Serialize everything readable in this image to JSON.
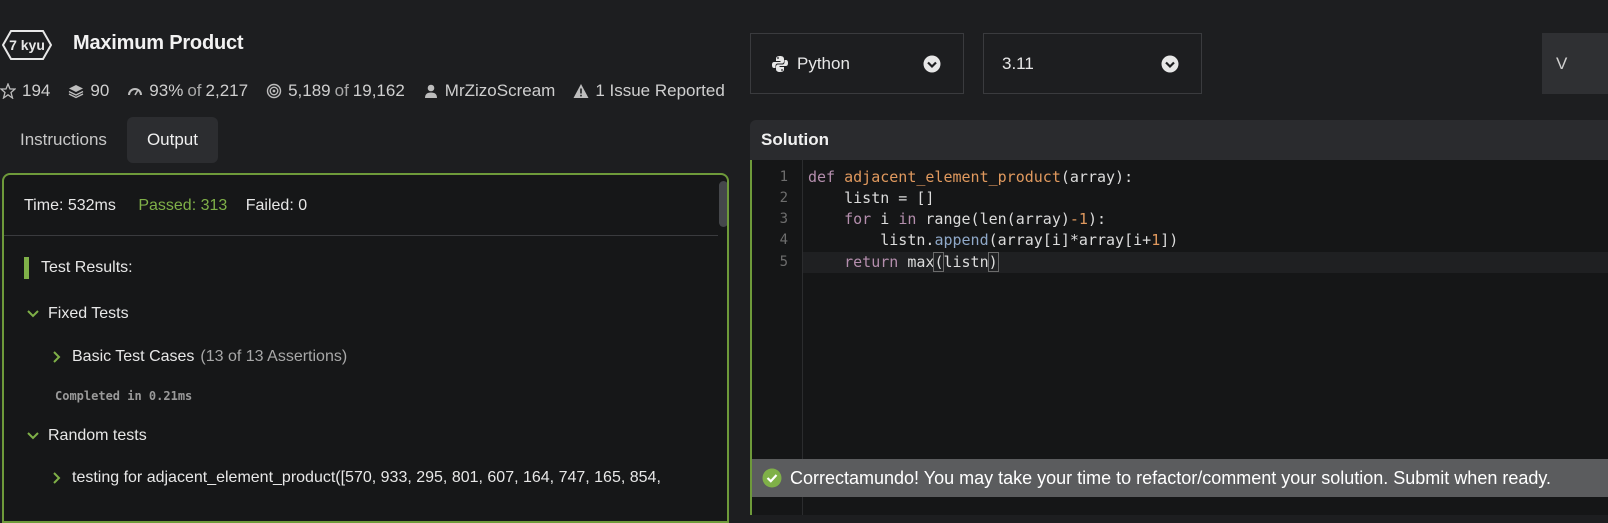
{
  "kata": {
    "rank": "7 kyu",
    "title": "Maximum Product",
    "stats": {
      "stars": "194",
      "collections": "90",
      "satisfaction_pct": "93%",
      "satisfaction_of": "of",
      "satisfaction_votes": "2,217",
      "completed": "5,189",
      "completed_of": "of",
      "completed_total": "19,162",
      "author": "MrZizoScream",
      "issues": "1 Issue Reported"
    }
  },
  "tabs": [
    {
      "label": "Instructions",
      "active": false
    },
    {
      "label": "Output",
      "active": true
    }
  ],
  "output": {
    "time": "Time: 532ms",
    "passed": "Passed: 313",
    "failed": "Failed: 0",
    "results_heading": "Test Results:",
    "groups": {
      "fixed": "Fixed Tests",
      "basic": "Basic Test Cases",
      "basic_count": "(13 of 13 Assertions)",
      "completed": "Completed in 0.21ms",
      "random": "Random tests",
      "random_case": "testing for adjacent_element_product([570, 933, 295, 801, 607, 164, 747, 165, 854,"
    }
  },
  "editor": {
    "language": "Python",
    "version": "3.11",
    "right_button": "V",
    "solution_label": "Solution",
    "line_numbers": [
      "1",
      "2",
      "3",
      "4",
      "5"
    ]
  },
  "toast": {
    "message": "Correctamundo! You may take your time to refactor/comment your solution. Submit when ready."
  },
  "icons": {
    "star": "star-icon",
    "collections": "layers-icon",
    "satisfaction": "gauge-icon",
    "completed": "target-icon",
    "author": "user-icon",
    "issues": "warning-icon",
    "language": "python-icon",
    "dropdown": "chevron-circle-down-icon",
    "success": "check-circle-icon"
  },
  "colors": {
    "accent_green": "#7fb048",
    "border_green": "#6e9a3a",
    "background": "#1d1e20"
  }
}
